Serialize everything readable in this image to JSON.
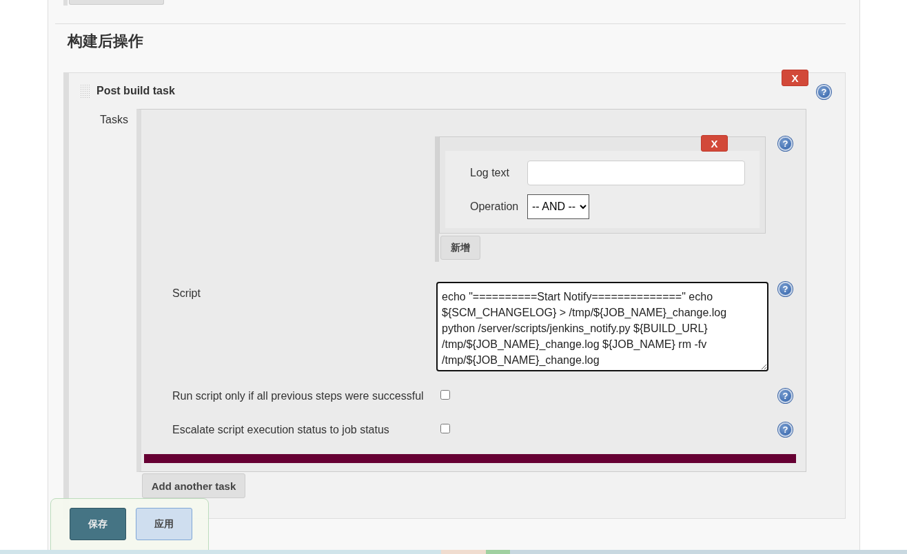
{
  "section_title": "构建后操作",
  "post_build_task": {
    "title": "Post build task",
    "delete_label": "X",
    "help": "?",
    "tasks_label": "Tasks",
    "log_condition": {
      "delete_label": "X",
      "help": "?",
      "log_text": {
        "label": "Log text"
      },
      "operation": {
        "label": "Operation",
        "value": "-- AND --"
      }
    },
    "add_condition_button": "新增",
    "script": {
      "label": "Script",
      "help": "?",
      "value": "echo \"==========Start Notify==============\" echo ${SCM_CHANGELOG} > /tmp/${JOB_NAME}_change.log python /server/scripts/jenkins_notify.py ${BUILD_URL} /tmp/${JOB_NAME}_change.log ${JOB_NAME} rm -fv /tmp/${JOB_NAME}_change.log"
    },
    "options": [
      {
        "label": "Run script only if all previous steps were successful",
        "checked": false,
        "help": "?"
      },
      {
        "label": "Escalate script execution status to job status",
        "checked": false,
        "help": "?"
      }
    ],
    "add_task_button": "Add another task"
  },
  "footer": {
    "buttons": [
      {
        "label": "保存",
        "kind": "primary"
      },
      {
        "label": "应用",
        "kind": "secondary"
      }
    ]
  }
}
